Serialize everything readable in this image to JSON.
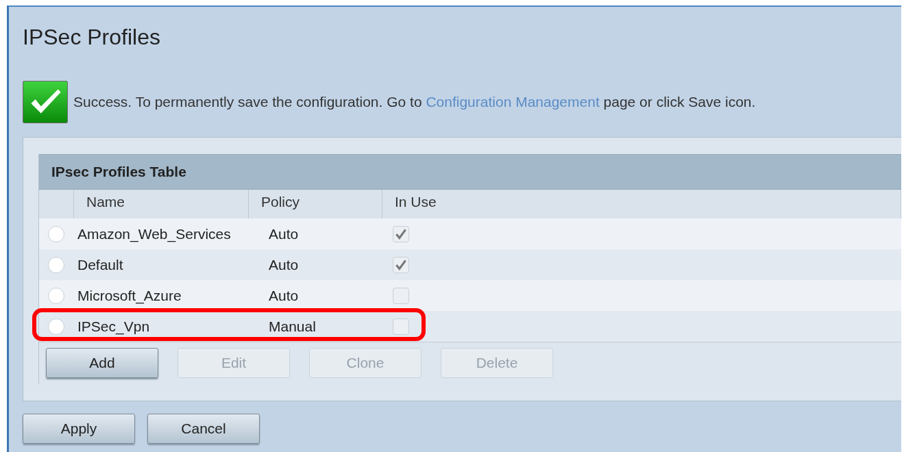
{
  "page": {
    "title": "IPSec Profiles"
  },
  "message": {
    "kind": "success",
    "before": "Success. To permanently save the configuration. Go to",
    "link": "Configuration Management",
    "after": "page or click Save icon."
  },
  "table": {
    "title": "IPsec Profiles Table",
    "columns": [
      "Name",
      "Policy",
      "In Use"
    ],
    "rows": [
      {
        "selected": false,
        "name": "Amazon_Web_Services",
        "policy": "Auto",
        "in_use": true,
        "highlighted": false
      },
      {
        "selected": false,
        "name": "Default",
        "policy": "Auto",
        "in_use": true,
        "highlighted": false
      },
      {
        "selected": false,
        "name": "Microsoft_Azure",
        "policy": "Auto",
        "in_use": false,
        "highlighted": false
      },
      {
        "selected": false,
        "name": "IPSec_Vpn",
        "policy": "Manual",
        "in_use": false,
        "highlighted": true
      }
    ],
    "buttons": [
      {
        "label": "Add",
        "disabled": false
      },
      {
        "label": "Edit",
        "disabled": true
      },
      {
        "label": "Clone",
        "disabled": true
      },
      {
        "label": "Delete",
        "disabled": true
      }
    ]
  },
  "buttons": [
    {
      "label": "Apply"
    },
    {
      "label": "Cancel"
    }
  ]
}
